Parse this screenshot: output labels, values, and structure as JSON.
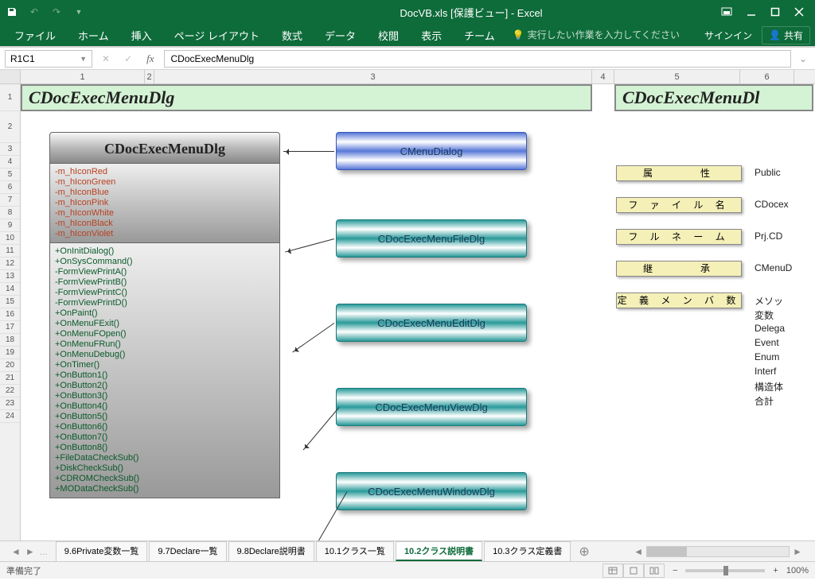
{
  "window": {
    "title": "DocVB.xls [保護ビュー] - Excel"
  },
  "ribbon": {
    "tabs": [
      "ファイル",
      "ホーム",
      "挿入",
      "ページ レイアウト",
      "数式",
      "データ",
      "校閲",
      "表示",
      "チーム"
    ],
    "tellme_placeholder": "実行したい作業を入力してください",
    "signin": "サインイン",
    "share": "共有"
  },
  "namebox": {
    "ref": "R1C1",
    "formula": "CDocExecMenuDlg"
  },
  "columns": [
    "1",
    "2",
    "3",
    "4",
    "5",
    "6"
  ],
  "rows": [
    "1",
    "2",
    "3",
    "4",
    "5",
    "6",
    "7",
    "8",
    "9",
    "10",
    "11",
    "12",
    "13",
    "14",
    "15",
    "16",
    "17",
    "18",
    "19",
    "20",
    "21",
    "22",
    "23",
    "24"
  ],
  "title1": "CDocExecMenuDlg",
  "title2": "CDocExecMenuDl",
  "uml": {
    "name": "CDocExecMenuDlg",
    "attrs": [
      "-m_hIconRed",
      "-m_hIconGreen",
      "-m_hIconBlue",
      "-m_hIconPink",
      "-m_hIconWhite",
      "-m_hIconBlack",
      "-m_hIconViolet"
    ],
    "ops": [
      "+OnInitDialog()",
      "+OnSysCommand()",
      "-FormViewPrintA()",
      "-FormViewPrintB()",
      "-FormViewPrintC()",
      "-FormViewPrintD()",
      "+OnPaint()",
      "+OnMenuFExit()",
      "+OnMenuFOpen()",
      "+OnMenuFRun()",
      "+OnMenuDebug()",
      "+OnTimer()",
      "+OnButton1()",
      "+OnButton2()",
      "+OnButton3()",
      "+OnButton4()",
      "+OnButton5()",
      "+OnButton6()",
      "+OnButton7()",
      "+OnButton8()",
      "+FileDataCheckSub()",
      "+DiskCheckSub()",
      "+CDROMCheckSub()",
      "+MODataCheckSub()"
    ]
  },
  "related": [
    "CMenuDialog",
    "CDocExecMenuFileDlg",
    "CDocExecMenuEditDlg",
    "CDocExecMenuViewDlg",
    "CDocExecMenuWindowDlg"
  ],
  "props": {
    "labels": [
      "属　　　性",
      "フ ァ イ ル 名",
      "フ ル ネ ー ム",
      "継　　　承",
      "定 義 メ ン バ 数"
    ],
    "values": [
      "Public",
      "CDocex",
      "Prj.CD",
      "CMenuD",
      "メソッ",
      "変数",
      "Delega",
      "Event",
      "Enum",
      "Interf",
      "構造体",
      "合計"
    ]
  },
  "sheettabs": {
    "items": [
      "9.6Private変数一覧",
      "9.7Declare一覧",
      "9.8Declare説明書",
      "10.1クラス一覧",
      "10.2クラス説明書",
      "10.3クラス定義書"
    ],
    "active": 4
  },
  "status": {
    "ready": "準備完了",
    "zoom": "100%"
  }
}
